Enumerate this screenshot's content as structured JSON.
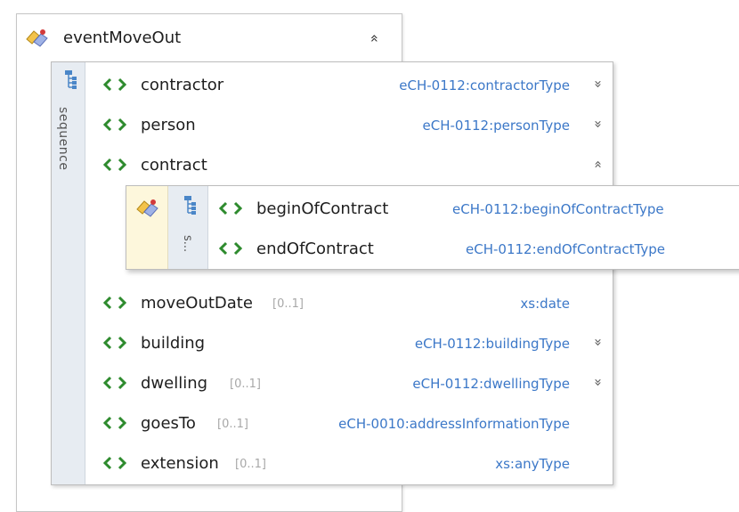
{
  "root": {
    "name": "eventMoveOut",
    "collapse_glyph": "»"
  },
  "sequence": {
    "label": "sequence",
    "elements": [
      {
        "name": "contractor",
        "cardinality": "",
        "type": "eCH-0112:contractorType",
        "expander": "»"
      },
      {
        "name": "person",
        "cardinality": "",
        "type": "eCH-0112:personType",
        "expander": "»"
      },
      {
        "name": "contract",
        "cardinality": "",
        "type": "",
        "expander": "»"
      },
      {
        "name": "moveOutDate",
        "cardinality": "[0..1]",
        "type": "xs:date",
        "expander": ""
      },
      {
        "name": "building",
        "cardinality": "",
        "type": "eCH-0112:buildingType",
        "expander": "»"
      },
      {
        "name": "dwelling",
        "cardinality": "[0..1]",
        "type": "eCH-0112:dwellingType",
        "expander": "»"
      },
      {
        "name": "goesTo",
        "cardinality": "[0..1]",
        "type": "eCH-0010:addressInformationType",
        "expander": ""
      },
      {
        "name": "extension",
        "cardinality": "[0..1]",
        "type": "xs:anyType",
        "expander": ""
      }
    ]
  },
  "contract_detail": {
    "sequence_label": "s...",
    "elements": [
      {
        "name": "beginOfContract",
        "type": "eCH-0112:beginOfContractType"
      },
      {
        "name": "endOfContract",
        "type": "eCH-0112:endOfContractType"
      }
    ]
  },
  "colors": {
    "type_text": "#3c78c8",
    "element_icon": "#2e8b2e",
    "sequence_strip": "#e7ecf2",
    "complex_strip": "#fdf7dc"
  }
}
